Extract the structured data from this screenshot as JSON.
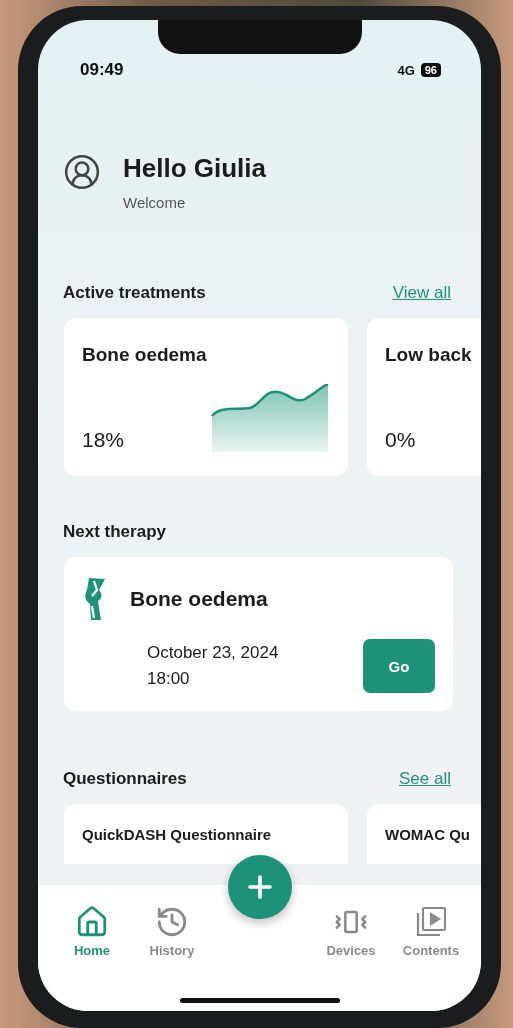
{
  "status_bar": {
    "time": "09:49",
    "network": "4G",
    "battery": "96"
  },
  "header": {
    "greeting": "Hello Giulia",
    "subtitle": "Welcome"
  },
  "active_treatments": {
    "title": "Active treatments",
    "link": "View all",
    "cards": [
      {
        "name": "Bone oedema",
        "percentage": "18%",
        "kind": "chart"
      },
      {
        "name": "Low back",
        "percentage": "0%",
        "kind": "plain"
      }
    ]
  },
  "next_therapy": {
    "title": "Next therapy",
    "name": "Bone oedema",
    "date": "October 23, 2024",
    "time": "18:00",
    "button": "Go"
  },
  "questionnaires": {
    "title": "Questionnaires",
    "link": "See all",
    "cards": [
      {
        "name": "QuickDASH Questionnaire"
      },
      {
        "name": "WOMAC Qu"
      }
    ]
  },
  "nav": {
    "items": [
      {
        "label": "Home",
        "selected": true
      },
      {
        "label": "History",
        "selected": false
      },
      {
        "label": "Devices",
        "selected": false
      },
      {
        "label": "Contents",
        "selected": false
      }
    ]
  }
}
